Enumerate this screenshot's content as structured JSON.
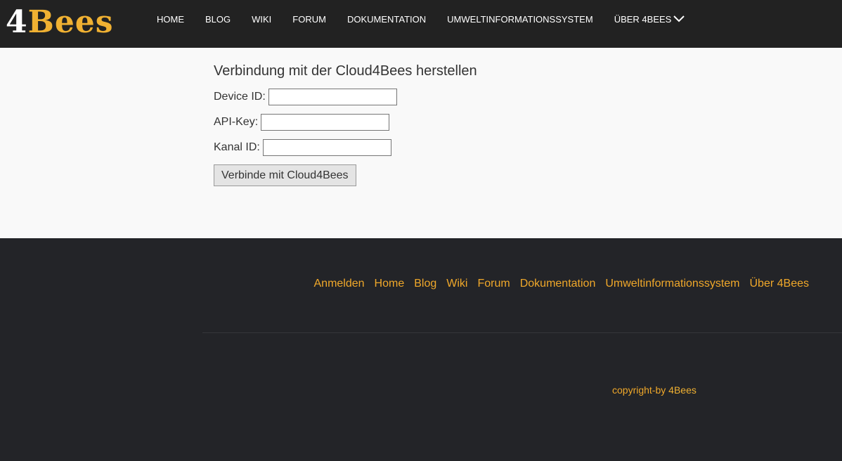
{
  "header": {
    "logo": {
      "part1": "4",
      "part2": "Bees"
    },
    "nav": [
      {
        "label": "HOME"
      },
      {
        "label": "BLOG"
      },
      {
        "label": "WIKI"
      },
      {
        "label": "FORUM"
      },
      {
        "label": "DOKUMENTATION"
      },
      {
        "label": "UMWELTINFORMATIONSSYSTEM"
      },
      {
        "label": "ÜBER 4BEES",
        "icon": "chevron-down-icon"
      }
    ]
  },
  "form": {
    "title": "Verbindung mit der Cloud4Bees herstellen",
    "device_id_label": "Device ID:",
    "device_id_value": "",
    "api_key_label": "API-Key:",
    "api_key_value": "",
    "channel_id_label": "Kanal ID:",
    "channel_id_value": "",
    "submit_label": "Verbinde mit Cloud4Bees"
  },
  "footer": {
    "links": [
      {
        "label": "Anmelden"
      },
      {
        "label": "Home"
      },
      {
        "label": "Blog"
      },
      {
        "label": "Wiki"
      },
      {
        "label": "Forum"
      },
      {
        "label": "Dokumentation"
      },
      {
        "label": "Umweltinformationssystem"
      },
      {
        "label": "Über 4Bees"
      }
    ],
    "copyright_prefix": "copyright-by",
    "copyright_brand": "4Bees"
  },
  "colors": {
    "header_bg": "#222222",
    "footer_bg": "#232428",
    "accent": "#f0b132",
    "link": "#f0a82a",
    "page_bg": "#f9f9f9"
  }
}
